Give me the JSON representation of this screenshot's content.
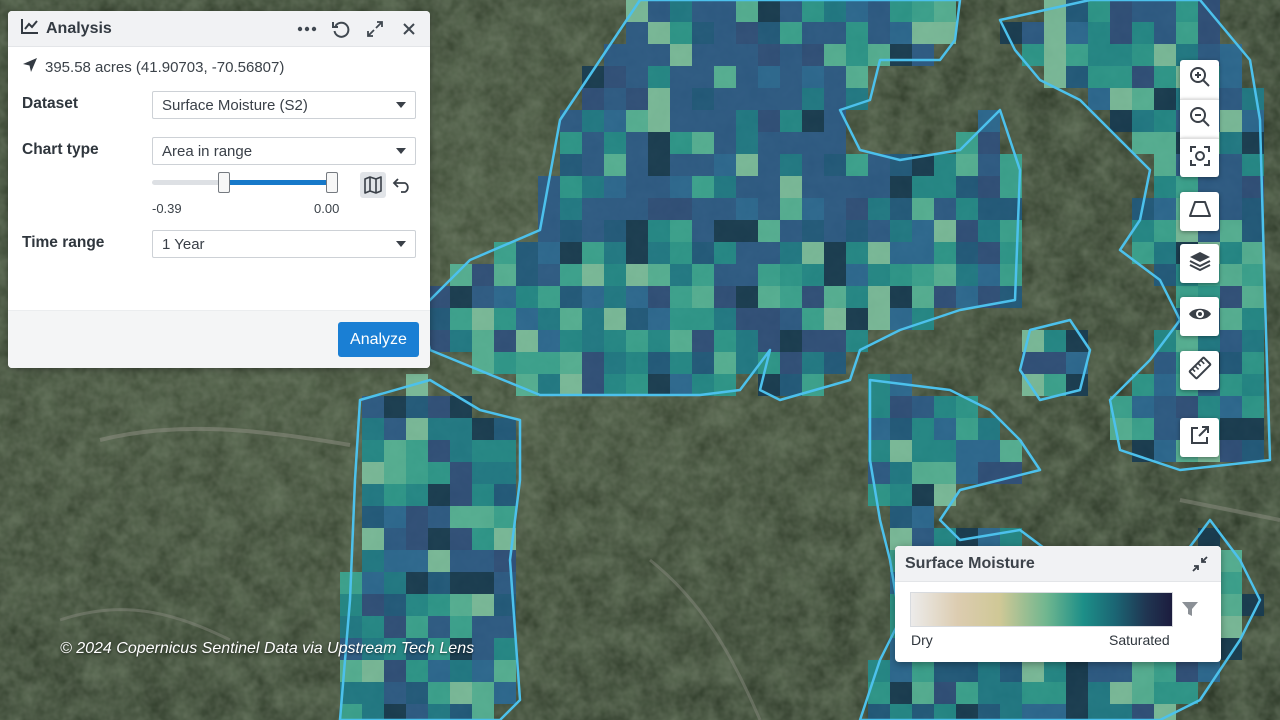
{
  "panel": {
    "title": "Analysis",
    "location": "395.58 acres (41.90703, -70.56807)",
    "dataset": {
      "label": "Dataset",
      "value": "Surface Moisture (S2)"
    },
    "chart_type": {
      "label": "Chart type",
      "value": "Area in range"
    },
    "range": {
      "min_label": "-0.39",
      "max_label": "0.00",
      "low_fraction": 0.38,
      "high_fraction": 1.0
    },
    "time_range": {
      "label": "Time range",
      "value": "1 Year"
    },
    "analyze_label": "Analyze"
  },
  "map": {
    "credit": "© 2024 Copernicus Sentinel Data via Upstream Tech Lens",
    "outline_color": "#4cc1ec",
    "tools": [
      "zoom-in-icon",
      "zoom-out-icon",
      "fit-bounds-icon",
      "draw-shape-icon",
      "layers-icon",
      "visibility-icon",
      "ruler-icon",
      "open-external-icon"
    ]
  },
  "legend": {
    "title": "Surface Moisture",
    "low_label": "Dry",
    "high_label": "Saturated"
  }
}
